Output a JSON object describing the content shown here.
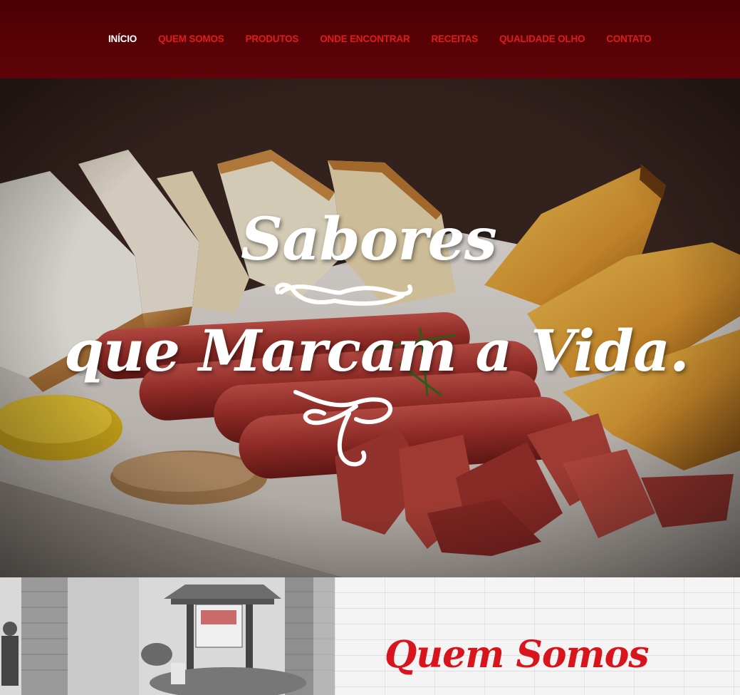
{
  "nav": {
    "items": [
      {
        "label": "INÍCIO",
        "active": true
      },
      {
        "label": "QUEM SOMOS",
        "active": false
      },
      {
        "label": "PRODUTOS",
        "active": false
      },
      {
        "label": "ONDE ENCONTRAR",
        "active": false
      },
      {
        "label": "RECEITAS",
        "active": false
      },
      {
        "label": "QUALIDADE OLHO",
        "active": false
      },
      {
        "label": "CONTATO",
        "active": false
      }
    ]
  },
  "hero": {
    "line1": "Sabores",
    "line2": "que Marcam a Vida."
  },
  "about": {
    "title": "Quem Somos"
  },
  "colors": {
    "nav_bg": "#560305",
    "nav_link": "#e01a1f",
    "nav_active": "#ffffff",
    "accent": "#d8151d"
  }
}
